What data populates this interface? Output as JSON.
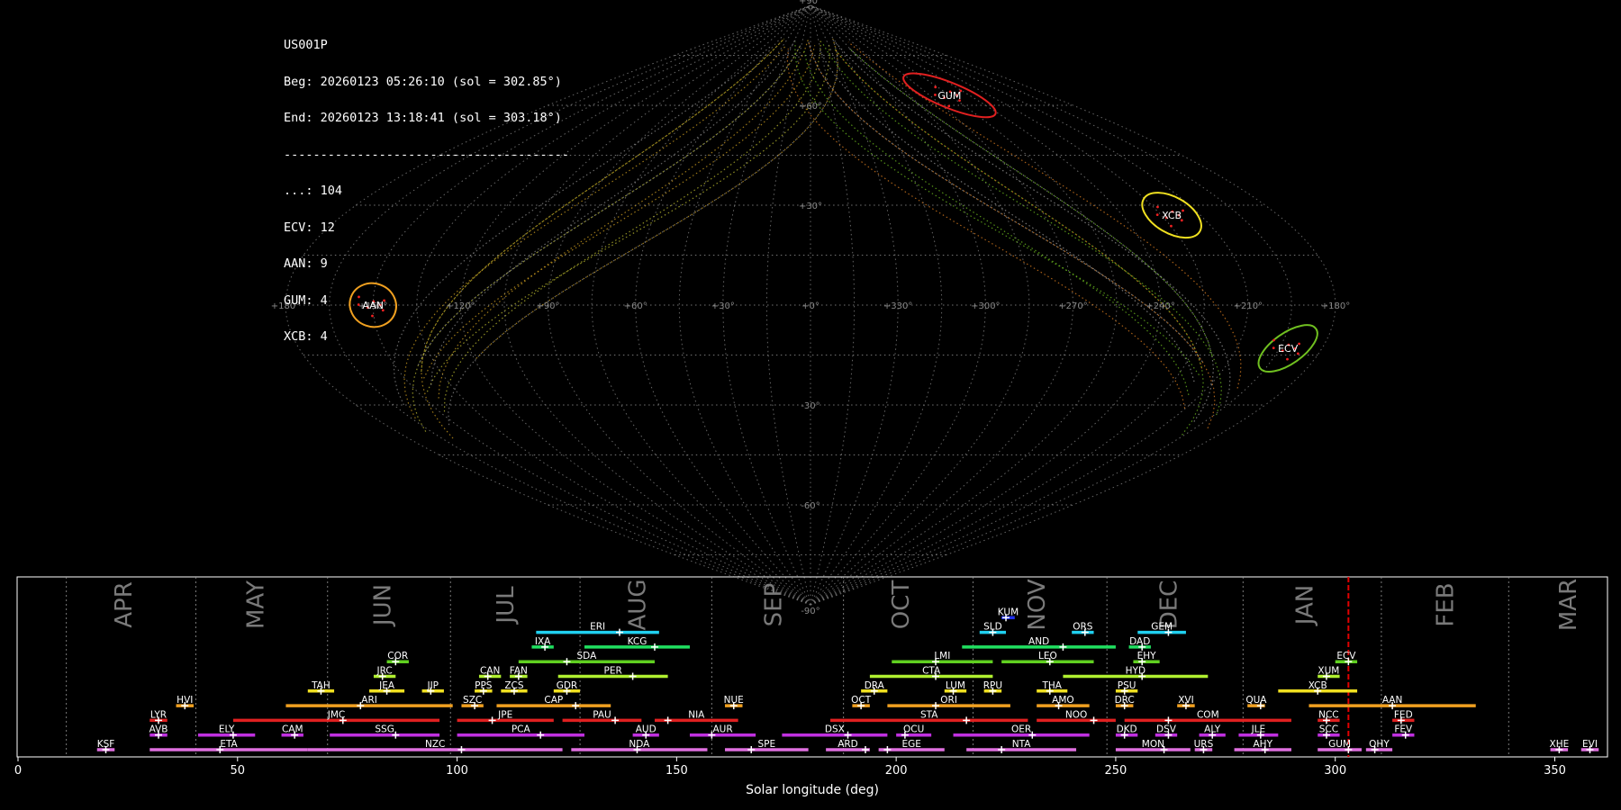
{
  "info": {
    "station": "US001P",
    "begin": "Beg: 20260123 05:26:10 (sol = 302.85°)",
    "end": "End: 20260123 13:18:41 (sol = 303.18°)",
    "separator": "---------------------------------------",
    "counts": [
      "...: 104",
      "ECV: 12",
      "AAN: 9",
      "GUM: 4",
      "XCB: 4"
    ]
  },
  "sky_map": {
    "projection": "sinusoidal",
    "lon_tick_labels": [
      "+180°",
      "+150°",
      "+120°",
      "+90°",
      "+60°",
      "+30°",
      "+0°",
      "+330°",
      "+300°",
      "+270°",
      "+240°",
      "+210°",
      "+180°"
    ],
    "lat_tick_labels": [
      "+90°",
      "+60°",
      "+30°",
      "-30°",
      "-60°",
      "-90°"
    ],
    "radiants": [
      {
        "code": "GUM",
        "lon": 255,
        "lat": 63,
        "color": "#e02020"
      },
      {
        "code": "XCB",
        "lon": 221,
        "lat": 27,
        "color": "#f0e020"
      },
      {
        "code": "AAN",
        "lon": 150,
        "lat": 0,
        "color": "#f0a020"
      },
      {
        "code": "ECV",
        "lon": 192,
        "lat": -13,
        "color": "#70c020"
      }
    ]
  },
  "chart_data": {
    "type": "timeline",
    "xlabel": "Solar longitude (deg)",
    "xlim": [
      0,
      362
    ],
    "x_ticks": [
      0,
      50,
      100,
      150,
      200,
      250,
      300,
      350
    ],
    "current_sol": 303,
    "months": [
      {
        "name": "APR",
        "start": 11,
        "label": 24
      },
      {
        "name": "MAY",
        "start": 40.5,
        "label": 54
      },
      {
        "name": "JUN",
        "start": 70.5,
        "label": 83
      },
      {
        "name": "JUL",
        "start": 98.5,
        "label": 111
      },
      {
        "name": "AUG",
        "start": 128,
        "label": 141
      },
      {
        "name": "SEP",
        "start": 158,
        "label": 172
      },
      {
        "name": "OCT",
        "start": 188,
        "label": 201
      },
      {
        "name": "NOV",
        "start": 217.5,
        "label": 232
      },
      {
        "name": "DEC",
        "start": 248,
        "label": 262
      },
      {
        "name": "JAN",
        "start": 279,
        "label": 293
      },
      {
        "name": "FEB",
        "start": 310.5,
        "label": 325
      },
      {
        "name": "MAR",
        "start": 339.5,
        "label": 353
      }
    ],
    "showers": [
      {
        "code": "KSF",
        "start": 18,
        "end": 22,
        "peak": 20,
        "row": 0,
        "color": "#e070e0"
      },
      {
        "code": "ETA",
        "start": 30,
        "end": 66,
        "peak": 46,
        "row": 0,
        "color": "#e070e0"
      },
      {
        "code": "NZC",
        "start": 66,
        "end": 124,
        "peak": 101,
        "row": 0,
        "color": "#e070e0"
      },
      {
        "code": "NDA",
        "start": 126,
        "end": 157,
        "peak": 141,
        "row": 0,
        "color": "#e070e0"
      },
      {
        "code": "SPE",
        "start": 161,
        "end": 180,
        "peak": 167,
        "row": 0,
        "color": "#e070e0"
      },
      {
        "code": "ARD",
        "start": 184,
        "end": 194,
        "peak": 193,
        "row": 0,
        "color": "#e070e0"
      },
      {
        "code": "EGE",
        "start": 196,
        "end": 211,
        "peak": 198,
        "row": 0,
        "color": "#e070e0"
      },
      {
        "code": "NTA",
        "start": 216,
        "end": 241,
        "peak": 224,
        "row": 0,
        "color": "#e070e0"
      },
      {
        "code": "MON",
        "start": 250,
        "end": 267,
        "peak": 261,
        "row": 0,
        "color": "#e070e0"
      },
      {
        "code": "URS",
        "start": 268,
        "end": 272,
        "peak": 270,
        "row": 0,
        "color": "#e070e0"
      },
      {
        "code": "AHY",
        "start": 277,
        "end": 290,
        "peak": 284,
        "row": 0,
        "color": "#e070e0"
      },
      {
        "code": "GUM",
        "start": 296,
        "end": 306,
        "peak": 303,
        "row": 0,
        "color": "#e070e0"
      },
      {
        "code": "OHY",
        "start": 307,
        "end": 313,
        "peak": 309,
        "row": 0,
        "color": "#e070e0"
      },
      {
        "code": "XHE",
        "start": 349,
        "end": 353,
        "peak": 351,
        "row": 0,
        "color": "#e070e0"
      },
      {
        "code": "EVI",
        "start": 356,
        "end": 360,
        "peak": 358,
        "row": 0,
        "color": "#e070e0"
      },
      {
        "code": "AVB",
        "start": 30,
        "end": 34,
        "peak": 32,
        "row": 1,
        "color": "#c030e0"
      },
      {
        "code": "ELY",
        "start": 41,
        "end": 54,
        "peak": 49,
        "row": 1,
        "color": "#c030e0"
      },
      {
        "code": "CAM",
        "start": 60,
        "end": 65,
        "peak": 63,
        "row": 1,
        "color": "#c030e0"
      },
      {
        "code": "SSG",
        "start": 71,
        "end": 96,
        "peak": 86,
        "row": 1,
        "color": "#c030e0"
      },
      {
        "code": "PCA",
        "start": 100,
        "end": 129,
        "peak": 119,
        "row": 1,
        "color": "#c030e0"
      },
      {
        "code": "AUD",
        "start": 140,
        "end": 146,
        "peak": 143,
        "row": 1,
        "color": "#c030e0"
      },
      {
        "code": "AUR",
        "start": 153,
        "end": 168,
        "peak": 158,
        "row": 1,
        "color": "#c030e0"
      },
      {
        "code": "DSX",
        "start": 174,
        "end": 198,
        "peak": 189,
        "row": 1,
        "color": "#c030e0"
      },
      {
        "code": "OCU",
        "start": 200,
        "end": 208,
        "peak": 202,
        "row": 1,
        "color": "#c030e0"
      },
      {
        "code": "OER",
        "start": 213,
        "end": 244,
        "peak": 231,
        "row": 1,
        "color": "#c030e0"
      },
      {
        "code": "DKD",
        "start": 250,
        "end": 255,
        "peak": 252,
        "row": 1,
        "color": "#c030e0"
      },
      {
        "code": "DSV",
        "start": 259,
        "end": 264,
        "peak": 262,
        "row": 1,
        "color": "#c030e0"
      },
      {
        "code": "ALY",
        "start": 269,
        "end": 275,
        "peak": 272,
        "row": 1,
        "color": "#c030e0"
      },
      {
        "code": "JLE",
        "start": 278,
        "end": 287,
        "peak": 283,
        "row": 1,
        "color": "#c030e0"
      },
      {
        "code": "SCC",
        "start": 296,
        "end": 301,
        "peak": 298,
        "row": 1,
        "color": "#c030e0"
      },
      {
        "code": "FEV",
        "start": 313,
        "end": 318,
        "peak": 316,
        "row": 1,
        "color": "#c030e0"
      },
      {
        "code": "LYR",
        "start": 30,
        "end": 34,
        "peak": 32,
        "row": 2,
        "color": "#e02020"
      },
      {
        "code": "JMC",
        "start": 49,
        "end": 96,
        "peak": 74,
        "row": 2,
        "color": "#e02020"
      },
      {
        "code": "JPE",
        "start": 100,
        "end": 122,
        "peak": 108,
        "row": 2,
        "color": "#e02020"
      },
      {
        "code": "PAU",
        "start": 124,
        "end": 142,
        "peak": 136,
        "row": 2,
        "color": "#e02020"
      },
      {
        "code": "NIA",
        "start": 145,
        "end": 164,
        "peak": 148,
        "row": 2,
        "color": "#e02020"
      },
      {
        "code": "STA",
        "start": 185,
        "end": 230,
        "peak": 216,
        "row": 2,
        "color": "#e02020"
      },
      {
        "code": "NOO",
        "start": 232,
        "end": 250,
        "peak": 245,
        "row": 2,
        "color": "#e02020"
      },
      {
        "code": "COM",
        "start": 252,
        "end": 290,
        "peak": 262,
        "row": 2,
        "color": "#e02020"
      },
      {
        "code": "NCC",
        "start": 296,
        "end": 301,
        "peak": 298,
        "row": 2,
        "color": "#e02020"
      },
      {
        "code": "FED",
        "start": 313,
        "end": 318,
        "peak": 315,
        "row": 2,
        "color": "#e02020"
      },
      {
        "code": "HVI",
        "start": 36,
        "end": 40,
        "peak": 38,
        "row": 3,
        "color": "#f0a020"
      },
      {
        "code": "ARI",
        "start": 61,
        "end": 99,
        "peak": 78,
        "row": 3,
        "color": "#f0a020"
      },
      {
        "code": "SZC",
        "start": 101,
        "end": 106,
        "peak": 104,
        "row": 3,
        "color": "#f0a020"
      },
      {
        "code": "CAP",
        "start": 109,
        "end": 135,
        "peak": 127,
        "row": 3,
        "color": "#f0a020"
      },
      {
        "code": "NUE",
        "start": 161,
        "end": 165,
        "peak": 163,
        "row": 3,
        "color": "#f0a020"
      },
      {
        "code": "OCT",
        "start": 190,
        "end": 194,
        "peak": 192,
        "row": 3,
        "color": "#f0a020"
      },
      {
        "code": "ORI",
        "start": 198,
        "end": 226,
        "peak": 209,
        "row": 3,
        "color": "#f0a020"
      },
      {
        "code": "AMO",
        "start": 232,
        "end": 244,
        "peak": 237,
        "row": 3,
        "color": "#f0a020"
      },
      {
        "code": "DRC",
        "start": 250,
        "end": 254,
        "peak": 252,
        "row": 3,
        "color": "#f0a020"
      },
      {
        "code": "XVI",
        "start": 264,
        "end": 268,
        "peak": 266,
        "row": 3,
        "color": "#f0a020"
      },
      {
        "code": "QUA",
        "start": 280,
        "end": 284,
        "peak": 283,
        "row": 3,
        "color": "#f0a020"
      },
      {
        "code": "AAN",
        "start": 294,
        "end": 332,
        "peak": 313,
        "row": 3,
        "color": "#f0a020"
      },
      {
        "code": "TAH",
        "start": 66,
        "end": 72,
        "peak": 69,
        "row": 4,
        "color": "#f0e020"
      },
      {
        "code": "JEA",
        "start": 80,
        "end": 88,
        "peak": 84,
        "row": 4,
        "color": "#f0e020"
      },
      {
        "code": "JIP",
        "start": 92,
        "end": 97,
        "peak": 94,
        "row": 4,
        "color": "#f0e020"
      },
      {
        "code": "PPS",
        "start": 104,
        "end": 108,
        "peak": 106,
        "row": 4,
        "color": "#f0e020"
      },
      {
        "code": "ZCS",
        "start": 110,
        "end": 116,
        "peak": 113,
        "row": 4,
        "color": "#f0e020"
      },
      {
        "code": "GDR",
        "start": 122,
        "end": 128,
        "peak": 125,
        "row": 4,
        "color": "#f0e020"
      },
      {
        "code": "DRA",
        "start": 192,
        "end": 198,
        "peak": 195,
        "row": 4,
        "color": "#f0e020"
      },
      {
        "code": "LUM",
        "start": 211,
        "end": 216,
        "peak": 213,
        "row": 4,
        "color": "#f0e020"
      },
      {
        "code": "RPU",
        "start": 220,
        "end": 224,
        "peak": 222,
        "row": 4,
        "color": "#f0e020"
      },
      {
        "code": "THA",
        "start": 232,
        "end": 239,
        "peak": 235,
        "row": 4,
        "color": "#f0e020"
      },
      {
        "code": "PSU",
        "start": 250,
        "end": 255,
        "peak": 252,
        "row": 4,
        "color": "#f0e020"
      },
      {
        "code": "XCB",
        "start": 287,
        "end": 305,
        "peak": 296,
        "row": 4,
        "color": "#f0e020"
      },
      {
        "code": "JRC",
        "start": 81,
        "end": 86,
        "peak": 83,
        "row": 5,
        "color": "#b0f030"
      },
      {
        "code": "CAN",
        "start": 105,
        "end": 110,
        "peak": 107,
        "row": 5,
        "color": "#b0f030"
      },
      {
        "code": "FAN",
        "start": 112,
        "end": 116,
        "peak": 114,
        "row": 5,
        "color": "#b0f030"
      },
      {
        "code": "PER",
        "start": 123,
        "end": 148,
        "peak": 140,
        "row": 5,
        "color": "#b0f030"
      },
      {
        "code": "CTA",
        "start": 194,
        "end": 222,
        "peak": 209,
        "row": 5,
        "color": "#b0f030"
      },
      {
        "code": "HYD",
        "start": 238,
        "end": 271,
        "peak": 256,
        "row": 5,
        "color": "#b0f030"
      },
      {
        "code": "XUM",
        "start": 296,
        "end": 301,
        "peak": 298,
        "row": 5,
        "color": "#b0f030"
      },
      {
        "code": "COR",
        "start": 84,
        "end": 89,
        "peak": 86,
        "row": 6,
        "color": "#60d020"
      },
      {
        "code": "SDA",
        "start": 114,
        "end": 145,
        "peak": 125,
        "row": 6,
        "color": "#60d020"
      },
      {
        "code": "LMI",
        "start": 199,
        "end": 222,
        "peak": 209,
        "row": 6,
        "color": "#60d020"
      },
      {
        "code": "LEO",
        "start": 224,
        "end": 245,
        "peak": 235,
        "row": 6,
        "color": "#60d020"
      },
      {
        "code": "EHY",
        "start": 254,
        "end": 260,
        "peak": 256,
        "row": 6,
        "color": "#60d020"
      },
      {
        "code": "ECV",
        "start": 300,
        "end": 305,
        "peak": 303,
        "row": 6,
        "color": "#60d020"
      },
      {
        "code": "IXA",
        "start": 117,
        "end": 122,
        "peak": 120,
        "row": 7,
        "color": "#20e060"
      },
      {
        "code": "KCG",
        "start": 129,
        "end": 153,
        "peak": 145,
        "row": 7,
        "color": "#20e060"
      },
      {
        "code": "AND",
        "start": 215,
        "end": 250,
        "peak": 238,
        "row": 7,
        "color": "#20e060"
      },
      {
        "code": "DAD",
        "start": 253,
        "end": 258,
        "peak": 256,
        "row": 7,
        "color": "#20e060"
      },
      {
        "code": "ERI",
        "start": 118,
        "end": 146,
        "peak": 137,
        "row": 8,
        "color": "#20d0f0"
      },
      {
        "code": "SLD",
        "start": 219,
        "end": 225,
        "peak": 222,
        "row": 8,
        "color": "#20d0f0"
      },
      {
        "code": "ORS",
        "start": 240,
        "end": 245,
        "peak": 243,
        "row": 8,
        "color": "#20d0f0"
      },
      {
        "code": "GEM",
        "start": 255,
        "end": 266,
        "peak": 262,
        "row": 8,
        "color": "#20d0f0"
      },
      {
        "code": "KUM",
        "start": 224,
        "end": 227,
        "peak": 225,
        "row": 9,
        "color": "#2030f0"
      }
    ]
  }
}
